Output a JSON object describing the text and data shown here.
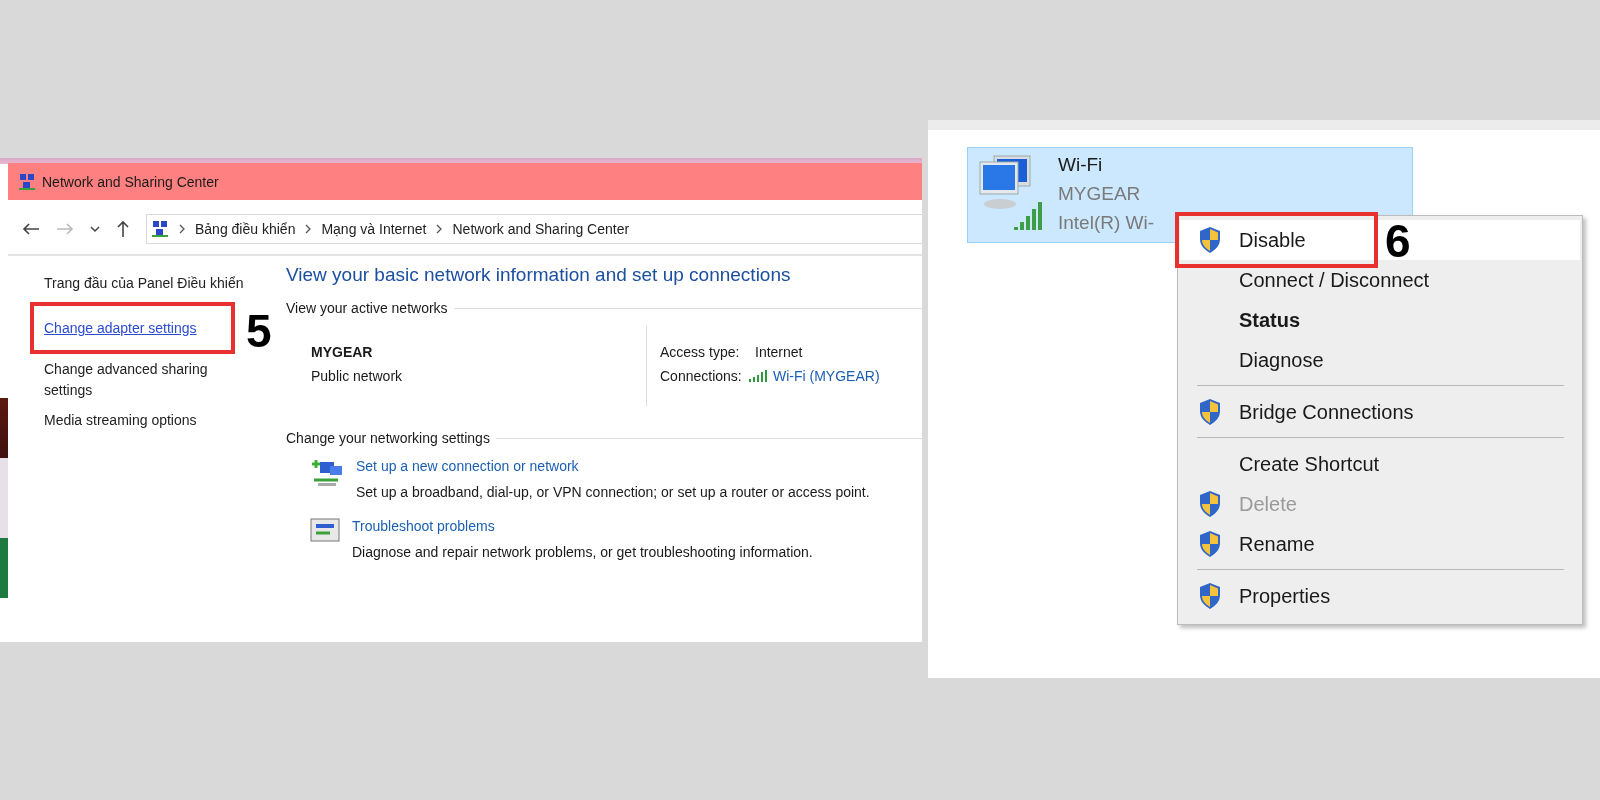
{
  "left_window": {
    "title": "Network and Sharing Center",
    "nav_buttons": [
      {
        "kind": "back",
        "disabled": false
      },
      {
        "kind": "forward",
        "disabled": true
      },
      {
        "kind": "recent",
        "disabled": false
      },
      {
        "kind": "up",
        "disabled": false
      }
    ],
    "breadcrumb": [
      "Bảng điều khiển",
      "Mạng và Internet",
      "Network and Sharing Center"
    ],
    "sidebar": {
      "items": [
        {
          "text": "Trang đầu của Panel Điều khiển",
          "kind": "plain"
        },
        {
          "text": "Change adapter settings",
          "kind": "link"
        },
        {
          "text": "Change advanced sharing settings",
          "kind": "plain"
        },
        {
          "text": "Media streaming options",
          "kind": "plain"
        }
      ]
    },
    "heading": "View your basic network information and set up connections",
    "active_networks": {
      "section_title": "View your active networks",
      "name": "MYGEAR",
      "type": "Public network",
      "access_type_label": "Access type:",
      "access_type": "Internet",
      "connections_label": "Connections:",
      "connection": "Wi-Fi (MYGEAR)"
    },
    "settings": {
      "section_title": "Change your networking settings",
      "tasks": [
        {
          "kind": "new-connection",
          "title": "Set up a new connection or network",
          "description": "Set up a broadband, dial-up, or VPN connection; or set up a router or access point."
        },
        {
          "kind": "troubleshoot",
          "title": "Troubleshoot problems",
          "description": "Diagnose and repair network problems, or get troubleshooting information."
        }
      ]
    },
    "step_label": "5"
  },
  "right_window": {
    "adapter": {
      "name": "Wi-Fi",
      "network": "MYGEAR",
      "device": "Intel(R) Wi-",
      "selected": true
    },
    "context_menu": [
      {
        "kind": "item",
        "label": "Disable",
        "shield": true,
        "bold": false,
        "disabled": false,
        "selected": true
      },
      {
        "kind": "item",
        "label": "Connect / Disconnect",
        "shield": false,
        "bold": false,
        "disabled": false,
        "selected": false
      },
      {
        "kind": "item",
        "label": "Status",
        "shield": false,
        "bold": true,
        "disabled": false,
        "selected": false
      },
      {
        "kind": "item",
        "label": "Diagnose",
        "shield": false,
        "bold": false,
        "disabled": false,
        "selected": false
      },
      {
        "kind": "separator"
      },
      {
        "kind": "item",
        "label": "Bridge Connections",
        "shield": true,
        "bold": false,
        "disabled": false,
        "selected": false
      },
      {
        "kind": "separator"
      },
      {
        "kind": "item",
        "label": "Create Shortcut",
        "shield": false,
        "bold": false,
        "disabled": false,
        "selected": false
      },
      {
        "kind": "item",
        "label": "Delete",
        "shield": true,
        "bold": false,
        "disabled": true,
        "selected": false
      },
      {
        "kind": "item",
        "label": "Rename",
        "shield": true,
        "bold": false,
        "disabled": false,
        "selected": false
      },
      {
        "kind": "separator"
      },
      {
        "kind": "item",
        "label": "Properties",
        "shield": true,
        "bold": false,
        "disabled": false,
        "selected": false
      }
    ],
    "step_label": "6"
  }
}
